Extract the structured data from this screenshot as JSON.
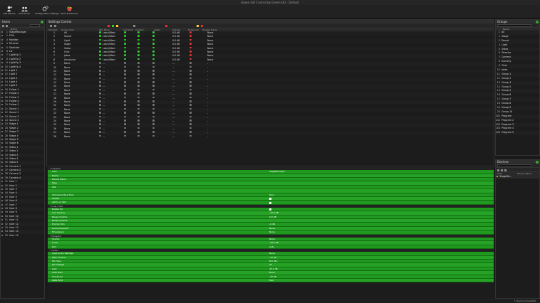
{
  "window": {
    "title": "Green-GO Control by Green-GO · Default"
  },
  "toolbar": [
    {
      "label": "Add Device",
      "icon": "add-user-icon",
      "color": "#ddd"
    },
    {
      "label": "Add Group",
      "icon": "add-group-icon",
      "color": "#ddd"
    },
    {
      "label": "Configuration Settings",
      "icon": "gears-icon",
      "color": "#ddd"
    },
    {
      "label": "Send To Devices",
      "icon": "send-to-devices-icon",
      "color": "#e33"
    }
  ],
  "users_panel": {
    "title": "Users",
    "col_name": "Name",
    "items": [
      {
        "n": "1",
        "name": "StageManager"
      },
      {
        "n": "2",
        "name": "FOH"
      },
      {
        "n": "3",
        "name": "Monitor"
      },
      {
        "n": "4",
        "name": "Director"
      },
      {
        "n": "5",
        "name": "Switcher"
      },
      {
        "n": "6",
        "name": "LD"
      },
      {
        "n": "7",
        "name": "LightOp 1"
      },
      {
        "n": "8",
        "name": "LightOp 2"
      },
      {
        "n": "9",
        "name": "LightOp 3"
      },
      {
        "n": "10",
        "name": "LightOp 4"
      },
      {
        "n": "11",
        "name": "Light 1"
      },
      {
        "n": "12",
        "name": "Light 2"
      },
      {
        "n": "13",
        "name": "Light 3"
      },
      {
        "n": "14",
        "name": "Light 4"
      },
      {
        "n": "15",
        "name": "Light 5"
      },
      {
        "n": "16",
        "name": "Follow 1"
      },
      {
        "n": "17",
        "name": "Follow 2"
      },
      {
        "n": "18",
        "name": "Follow 3"
      },
      {
        "n": "19",
        "name": "Follow 4"
      },
      {
        "n": "20",
        "name": "Follow 5"
      },
      {
        "n": "21",
        "name": "Sound 1"
      },
      {
        "n": "22",
        "name": "Sound 2"
      },
      {
        "n": "23",
        "name": "Sound 3"
      },
      {
        "n": "24",
        "name": "Sound 4"
      },
      {
        "n": "25",
        "name": "Stage 1"
      },
      {
        "n": "26",
        "name": "Stage 2"
      },
      {
        "n": "27",
        "name": "Stage 3"
      },
      {
        "n": "28",
        "name": "Stage 4"
      },
      {
        "n": "29",
        "name": "Stage 5"
      },
      {
        "n": "30",
        "name": "Stage 6"
      },
      {
        "n": "31",
        "name": "Video 1"
      },
      {
        "n": "32",
        "name": "Video 2"
      },
      {
        "n": "33",
        "name": "Video 3"
      },
      {
        "n": "34",
        "name": "Video 4"
      },
      {
        "n": "35",
        "name": "Video 5"
      },
      {
        "n": "36",
        "name": "Camera 1"
      },
      {
        "n": "37",
        "name": "Camera 2"
      },
      {
        "n": "38",
        "name": "Camera 3"
      },
      {
        "n": "39",
        "name": "Camera 4"
      },
      {
        "n": "41",
        "name": "User 1"
      },
      {
        "n": "42",
        "name": "User 2"
      },
      {
        "n": "43",
        "name": "User 3"
      },
      {
        "n": "44",
        "name": "User 4"
      },
      {
        "n": "45",
        "name": "User 5"
      },
      {
        "n": "46",
        "name": "User 6"
      },
      {
        "n": "47",
        "name": "User 7"
      },
      {
        "n": "48",
        "name": "User 8"
      },
      {
        "n": "49",
        "name": "User 9"
      },
      {
        "n": "50",
        "name": "User 10"
      },
      {
        "n": "51",
        "name": "User 11"
      },
      {
        "n": "52",
        "name": "User 12"
      },
      {
        "n": "53",
        "name": "User 13"
      },
      {
        "n": "54",
        "name": "User 14"
      },
      {
        "n": "55",
        "name": "User 15"
      }
    ]
  },
  "settings_panel": {
    "title": "Settings Control",
    "columns": [
      "Channel",
      "Group Color",
      "Talk Mode",
      "Call Send",
      "Call Rec...",
      "Listen",
      "Volume",
      "Enhanced",
      "Display Name"
    ],
    "rows": [
      {
        "ch": "1",
        "name": "All",
        "mode": "Latch/Mom",
        "vol": "0.0 dB",
        "disp": "None",
        "active": true
      },
      {
        "ch": "2",
        "name": "Sound",
        "mode": "Latch/Mom",
        "vol": "0.0 dB",
        "disp": "None",
        "active": true
      },
      {
        "ch": "3",
        "name": "Light",
        "mode": "Latch/Mom",
        "vol": "0.0 dB",
        "disp": "None",
        "active": true
      },
      {
        "ch": "4",
        "name": "Stage",
        "mode": "Latch/Mom",
        "vol": "0.0 dB",
        "disp": "None",
        "active": true
      },
      {
        "ch": "5",
        "name": "Video",
        "mode": "Latch/Mom",
        "vol": "0.0 dB",
        "disp": "None",
        "active": true
      },
      {
        "ch": "6",
        "name": "Chat",
        "mode": "Latch/Mom",
        "vol": "0.0 dB",
        "disp": "None",
        "active": true
      },
      {
        "ch": "7",
        "name": "Jokes",
        "mode": "Latch/Mom",
        "vol": "0.0 dB",
        "disp": "None",
        "active": true
      },
      {
        "ch": "8",
        "name": "Announce",
        "mode": "Latch/Mom",
        "vol": "0.0 dB",
        "disp": "None",
        "active": true
      },
      {
        "ch": "9",
        "name": "None",
        "mode": "-.-",
        "vol": "-.-",
        "disp": "-",
        "active": false
      },
      {
        "ch": "10",
        "name": "None",
        "mode": "-.-",
        "vol": "-.-",
        "disp": "-",
        "active": false
      },
      {
        "ch": "11",
        "name": "None",
        "mode": "-.-",
        "vol": "-.-",
        "disp": "-",
        "active": false
      },
      {
        "ch": "12",
        "name": "None",
        "mode": "-.-",
        "vol": "-.-",
        "disp": "-",
        "active": false
      },
      {
        "ch": "13",
        "name": "None",
        "mode": "-.-",
        "vol": "-.-",
        "disp": "-",
        "active": false
      },
      {
        "ch": "14",
        "name": "None",
        "mode": "-.-",
        "vol": "-.-",
        "disp": "-",
        "active": false
      },
      {
        "ch": "15",
        "name": "None",
        "mode": "-.-",
        "vol": "-.-",
        "disp": "-",
        "active": false
      },
      {
        "ch": "16",
        "name": "None",
        "mode": "-.-",
        "vol": "-.-",
        "disp": "-",
        "active": false
      },
      {
        "ch": "17",
        "name": "None",
        "mode": "-.-",
        "vol": "-.-",
        "disp": "-",
        "active": false
      },
      {
        "ch": "18",
        "name": "None",
        "mode": "-.-",
        "vol": "-.-",
        "disp": "-",
        "active": false
      },
      {
        "ch": "19",
        "name": "None",
        "mode": "-.-",
        "vol": "-.-",
        "disp": "-",
        "active": false
      },
      {
        "ch": "20",
        "name": "None",
        "mode": "-.-",
        "vol": "-.-",
        "disp": "-",
        "active": false
      },
      {
        "ch": "21",
        "name": "None",
        "mode": "-.-",
        "vol": "-.-",
        "disp": "-",
        "active": false
      },
      {
        "ch": "22",
        "name": "None",
        "mode": "-.-",
        "vol": "-.-",
        "disp": "-",
        "active": false
      },
      {
        "ch": "23",
        "name": "None",
        "mode": "-.-",
        "vol": "-.-",
        "disp": "-",
        "active": false
      },
      {
        "ch": "24",
        "name": "None",
        "mode": "-.-",
        "vol": "-.-",
        "disp": "-",
        "active": false
      },
      {
        "ch": "25",
        "name": "None",
        "mode": "-.-",
        "vol": "-.-",
        "disp": "-",
        "active": false
      },
      {
        "ch": "26",
        "name": "None",
        "mode": "-.-",
        "vol": "-.-",
        "disp": "-",
        "active": false
      },
      {
        "ch": "27",
        "name": "None",
        "mode": "-.-",
        "vol": "-.-",
        "disp": "-",
        "active": false
      },
      {
        "ch": "28",
        "name": "None",
        "mode": "-.-",
        "vol": "-.-",
        "disp": "-",
        "active": false
      }
    ]
  },
  "properties": {
    "sections": [
      {
        "title": "Generic",
        "rows": [
          {
            "k": "User",
            "v": "StageManager"
          },
          {
            "k": "Name",
            "v": ""
          },
          {
            "k": "Device Name",
            "v": ""
          },
          {
            "k": "Type",
            "v": ""
          },
          {
            "k": "Talk",
            "v": ""
          },
          {
            "k": "",
            "v": ""
          },
          {
            "k": "Channel Active Time",
            "v": "8.0 s"
          },
          {
            "k": "Isolate",
            "v": "",
            "chk": true
          },
          {
            "k": "Latch on Talk",
            "v": "",
            "chk": true
          }
        ]
      },
      {
        "title": "Cue / Call",
        "rows": [
          {
            "k": "Buzzer On",
            "v": "",
            "chk": true
          },
          {
            "k": "Cue Volume",
            "v": "-12.0 dB"
          },
          {
            "k": "Beeps Volume",
            "v": "0.0 dB"
          },
          {
            "k": "Beeps Volume",
            "v": ""
          },
          {
            "k": "Priority Dim",
            "v": "-6 dB"
          },
          {
            "k": "Announcement",
            "v": "None"
          },
          {
            "k": "Emergency",
            "v": "None"
          }
        ]
      },
      {
        "title": "Program",
        "rows": [
          {
            "k": "Source",
            "v": "None"
          },
          {
            "k": "Level",
            "v": "-18.0 dB"
          },
          {
            "k": "Dim",
            "v": "Auto"
          }
        ]
      },
      {
        "title": "Audio",
        "rows": [
          {
            "k": "Load Audio Settings",
            "v": "None"
          },
          {
            "k": "Main Volume",
            "v": "-12 dB"
          },
          {
            "k": "Mic Type",
            "v": "Ext. Mic"
          },
          {
            "k": "Mic Voltage",
            "v": "0V"
          },
          {
            "k": "Gain",
            "v": "40.0 dB"
          },
          {
            "k": "Auto Gain",
            "v": "None"
          },
          {
            "k": "Threshold",
            "v": "-30 dB"
          },
          {
            "k": "Gate Hold",
            "v": "Fast"
          }
        ]
      }
    ]
  },
  "groups_panel": {
    "title": "Groups",
    "col_name": "Name",
    "items": [
      {
        "n": "1",
        "name": "All"
      },
      {
        "n": "2",
        "name": "Stage"
      },
      {
        "n": "3",
        "name": "Sound"
      },
      {
        "n": "4",
        "name": "Light"
      },
      {
        "n": "5",
        "name": "Video"
      },
      {
        "n": "6",
        "name": "Director"
      },
      {
        "n": "7",
        "name": "Camera"
      },
      {
        "n": "8",
        "name": "Scenery"
      },
      {
        "n": "9",
        "name": "Chat"
      },
      {
        "n": "10",
        "name": "Jokes"
      },
      {
        "n": "11",
        "name": "Group 1"
      },
      {
        "n": "12",
        "name": "Group 2"
      },
      {
        "n": "13",
        "name": "Group 3"
      },
      {
        "n": "14",
        "name": "Group 4"
      },
      {
        "n": "15",
        "name": "Group 5"
      },
      {
        "n": "16",
        "name": "Group 6"
      },
      {
        "n": "17",
        "name": "Group 7"
      },
      {
        "n": "18",
        "name": "Group 8"
      },
      {
        "n": "19",
        "name": "Group 9"
      },
      {
        "n": "20",
        "name": "Group 10"
      },
      {
        "n": "201",
        "name": "Program"
      },
      {
        "n": "202",
        "name": "Program 2"
      },
      {
        "n": "203",
        "name": "Program 3"
      },
      {
        "n": "204",
        "name": "Program 4"
      },
      {
        "n": "205",
        "name": "Program 5"
      }
    ]
  },
  "devices_panel": {
    "title": "Devices",
    "col_user": "User",
    "col_name": "Device Name",
    "items": [
      {
        "user": "StageMa...",
        "name": ""
      }
    ]
  },
  "status": {
    "text": "1 Device Connected"
  }
}
